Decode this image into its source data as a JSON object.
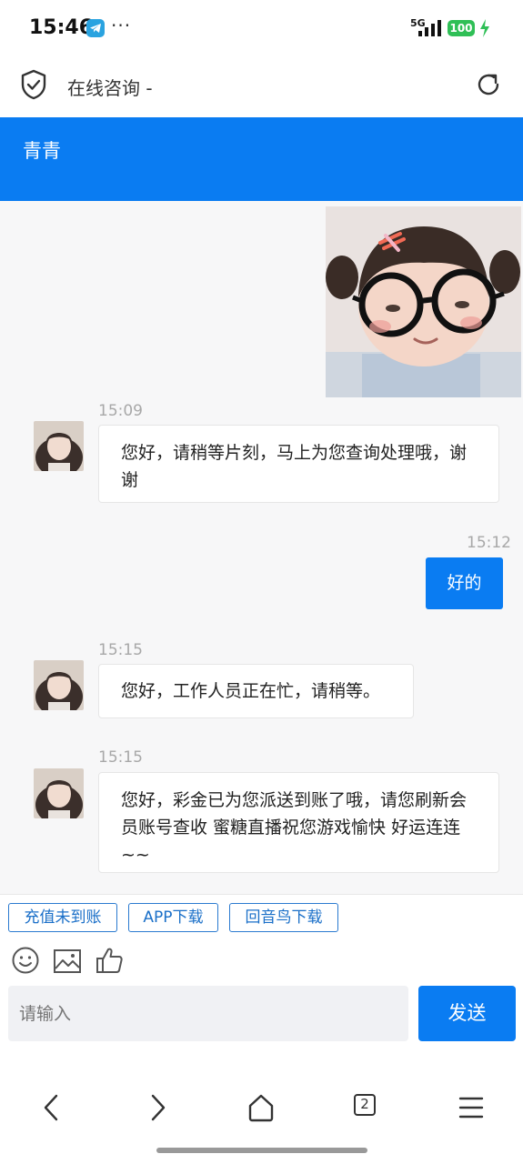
{
  "status_bar": {
    "time": "15:46",
    "more": "···",
    "network": "5G",
    "battery": "100"
  },
  "header": {
    "title": "在线咨询 -",
    "agent_name": "青青"
  },
  "messages": [
    {
      "type": "image",
      "from": "user",
      "description": "sticker"
    },
    {
      "type": "text",
      "from": "agent",
      "time": "15:09",
      "text": "您好，请稍等片刻，马上为您查询处理哦，谢谢"
    },
    {
      "type": "text",
      "from": "user",
      "time": "15:12",
      "text": "好的"
    },
    {
      "type": "text",
      "from": "agent",
      "time": "15:15",
      "text": "您好，工作人员正在忙，请稍等。"
    },
    {
      "type": "text",
      "from": "agent",
      "time": "15:15",
      "text": "您好，彩金已为您派送到账了哦，请您刷新会员账号查收 蜜糖直播祝您游戏愉快 好运连连~~"
    }
  ],
  "quick_replies": [
    "充值未到账",
    "APP下载",
    "回音鸟下载"
  ],
  "tools": [
    "emoji-icon",
    "image-icon",
    "thumbs-up-icon"
  ],
  "input": {
    "placeholder": "请输入",
    "value": ""
  },
  "send_label": "发送",
  "browser_nav": {
    "tab_count": "2"
  },
  "colors": {
    "accent": "#0a7cf2",
    "telegram": "#2aa3e0",
    "battery": "#2fbf56"
  }
}
